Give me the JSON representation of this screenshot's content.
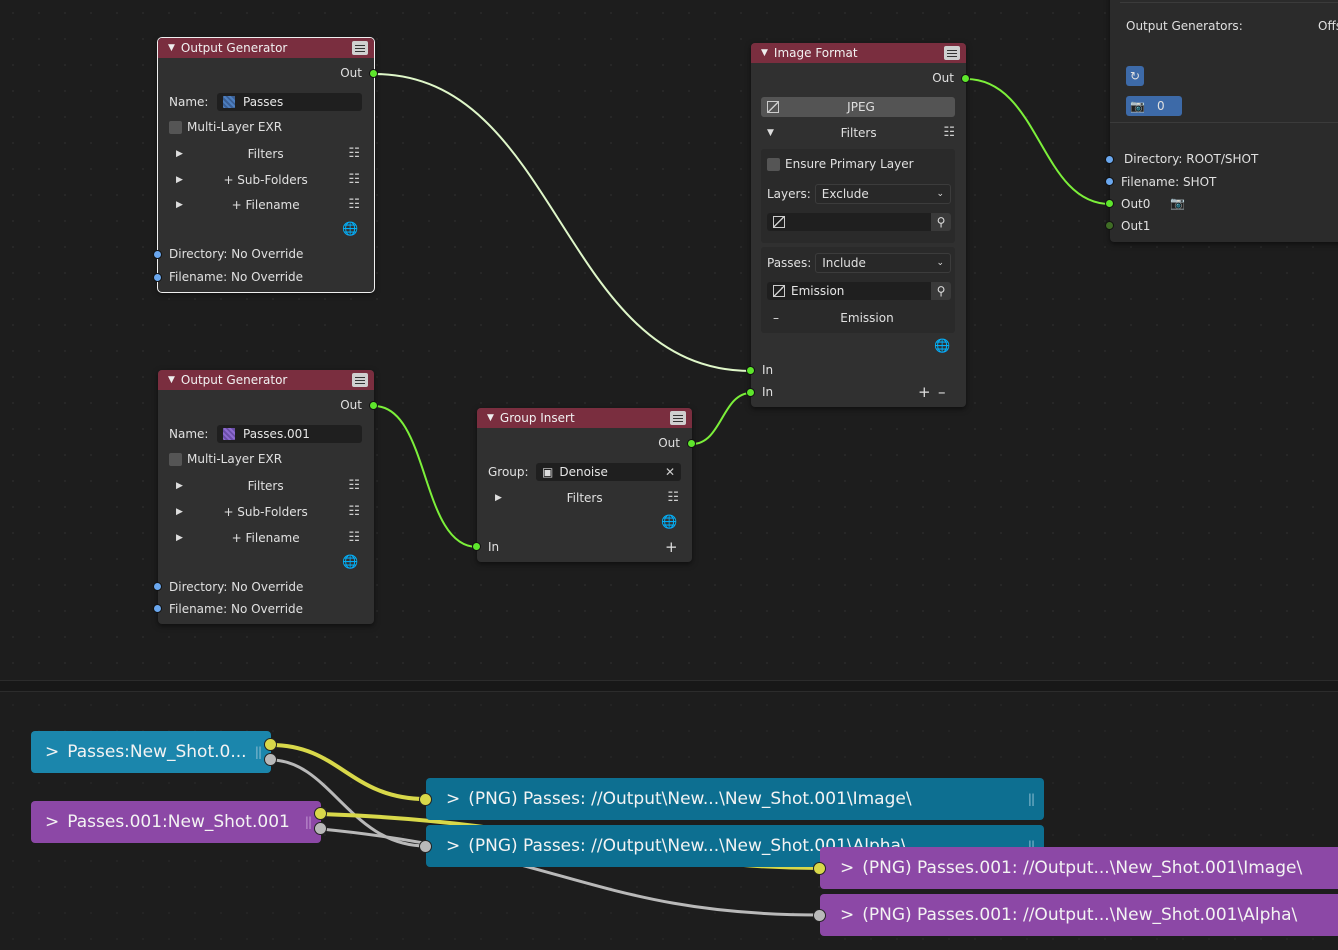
{
  "colors": {
    "node_header": "#7a2e3f",
    "socket_green": "#5ee62c",
    "socket_blue": "#6aa7ee",
    "wire_green": "#7cf03a",
    "wire_selected": "#dff7c9",
    "pill_teal": "#1b86ac",
    "pill_purple": "#8c48a6",
    "wire_yellow": "#d8d84a",
    "wire_gray": "#b9b9b9"
  },
  "output_generator_1": {
    "title": "Output Generator",
    "out_label": "Out",
    "name_label": "Name:",
    "name_value": "Passes",
    "multilayer_label": "Multi-Layer EXR",
    "filters_label": "Filters",
    "subfolders_label": "+ Sub-Folders",
    "filename_label": "+ Filename",
    "directory_label": "Directory: No Override",
    "filename_override_label": "Filename: No Override"
  },
  "output_generator_2": {
    "title": "Output Generator",
    "out_label": "Out",
    "name_label": "Name:",
    "name_value": "Passes.001",
    "multilayer_label": "Multi-Layer EXR",
    "filters_label": "Filters",
    "subfolders_label": "+ Sub-Folders",
    "filename_label": "+ Filename",
    "directory_label": "Directory: No Override",
    "filename_override_label": "Filename: No Override"
  },
  "group_insert": {
    "title": "Group Insert",
    "out_label": "Out",
    "group_label": "Group:",
    "group_value": "Denoise",
    "filters_label": "Filters",
    "in_label": "In"
  },
  "image_format": {
    "title": "Image Format",
    "out_label": "Out",
    "format_value": "JPEG",
    "filters_label": "Filters",
    "ensure_primary_label": "Ensure Primary Layer",
    "layers_label": "Layers:",
    "layers_value": "Exclude",
    "passes_label": "Passes:",
    "passes_value": "Include",
    "passes_search_value": "Emission",
    "passes_item": "Emission",
    "in1_label": "In",
    "in2_label": "In"
  },
  "output_panel": {
    "output_generators_label": "Output Generators:",
    "offset_label": "Offs",
    "count_value": "0",
    "directory_label": "Directory: ROOT/SHOT",
    "filename_label": "Filename: SHOT",
    "out0_label": "Out0",
    "out1_label": "Out1"
  },
  "bottom_view": {
    "src1": "Passes:New_Shot.0...",
    "src2": "Passes.001:New_Shot.001",
    "dst1": "(PNG) Passes: //Output\\New...\\New_Shot.001\\Image\\",
    "dst2": "(PNG) Passes: //Output\\New...\\New_Shot.001\\Alpha\\",
    "dst3": "(PNG) Passes.001: //Output...\\New_Shot.001\\Image\\",
    "dst4": "(PNG) Passes.001: //Output...\\New_Shot.001\\Alpha\\",
    "chevron": ">",
    "grip": "||"
  }
}
